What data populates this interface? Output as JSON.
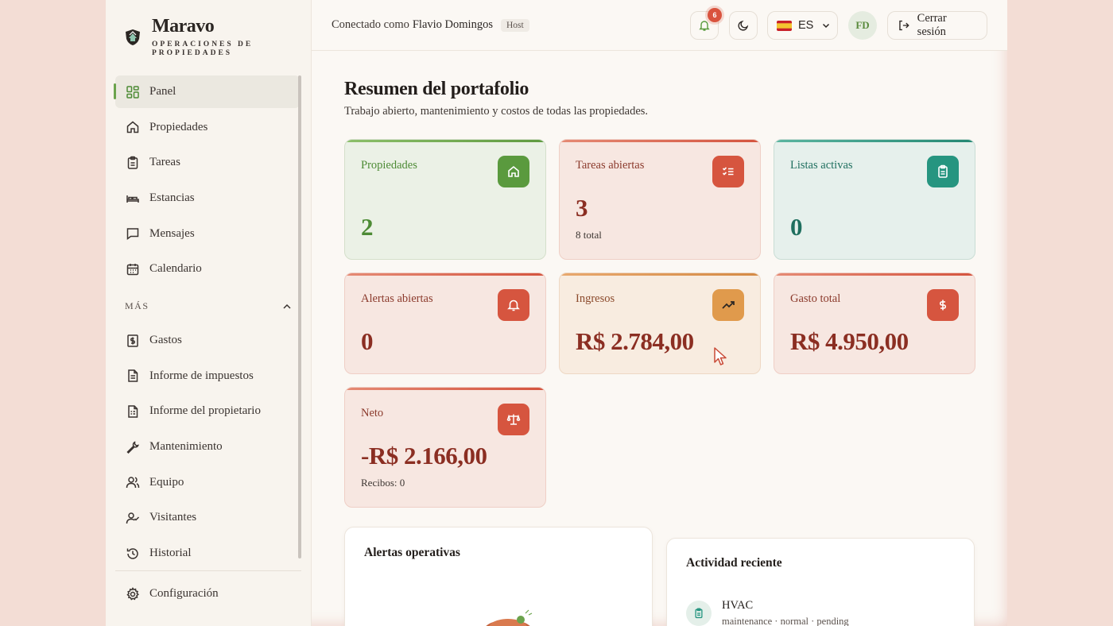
{
  "brand": {
    "name": "Maravo",
    "subtitle_line1": "OPERACIONES DE",
    "subtitle_line2": "PROPIEDADES"
  },
  "sidebar": {
    "items": [
      {
        "label": "Panel",
        "icon": "grid-icon",
        "active": true
      },
      {
        "label": "Propiedades",
        "icon": "home-icon"
      },
      {
        "label": "Tareas",
        "icon": "clipboard-icon"
      },
      {
        "label": "Estancias",
        "icon": "bed-icon"
      },
      {
        "label": "Mensajes",
        "icon": "message-icon"
      },
      {
        "label": "Calendario",
        "icon": "calendar-icon"
      }
    ],
    "section_label": "MÁS",
    "more_items": [
      {
        "label": "Gastos",
        "icon": "dollar-receipt-icon"
      },
      {
        "label": "Informe de impuestos",
        "icon": "document-icon"
      },
      {
        "label": "Informe del propietario",
        "icon": "document-lines-icon"
      },
      {
        "label": "Mantenimiento",
        "icon": "wrench-icon"
      },
      {
        "label": "Equipo",
        "icon": "users-icon"
      },
      {
        "label": "Visitantes",
        "icon": "user-check-icon"
      },
      {
        "label": "Historial",
        "icon": "history-icon"
      }
    ],
    "settings_label": "Configuración"
  },
  "topbar": {
    "connected_prefix": "Conectado como",
    "user_name": "Flavio Domingos",
    "role_badge": "Host",
    "notifications_count": "6",
    "language": "ES",
    "avatar_initials": "FD",
    "logout_label": "Cerrar sesión"
  },
  "main": {
    "title": "Resumen del portafolio",
    "subtitle": "Trabajo abierto, mantenimiento y costos de todas las propiedades.",
    "cards": {
      "properties": {
        "label": "Propiedades",
        "value": "2"
      },
      "open_tasks": {
        "label": "Tareas abiertas",
        "value": "3",
        "note": "8 total"
      },
      "active_lists": {
        "label": "Listas activas",
        "value": "0"
      },
      "open_alerts": {
        "label": "Alertas abiertas",
        "value": "0"
      },
      "income": {
        "label": "Ingresos",
        "value": "R$ 2.784,00"
      },
      "total_expense": {
        "label": "Gasto total",
        "value": "R$ 4.950,00"
      },
      "net": {
        "label": "Neto",
        "value": "-R$ 2.166,00",
        "note": "Recibos: 0"
      }
    },
    "alerts_panel": {
      "title": "Alertas operativas"
    },
    "activity_panel": {
      "title": "Actividad reciente",
      "items": [
        {
          "title": "HVAC",
          "meta": "maintenance · normal · pending"
        }
      ]
    }
  },
  "colors": {
    "green": "#5a9a3e",
    "red": "#d6553f",
    "teal": "#269580",
    "amber": "#e09a4c",
    "wine": "#8b2e22"
  }
}
